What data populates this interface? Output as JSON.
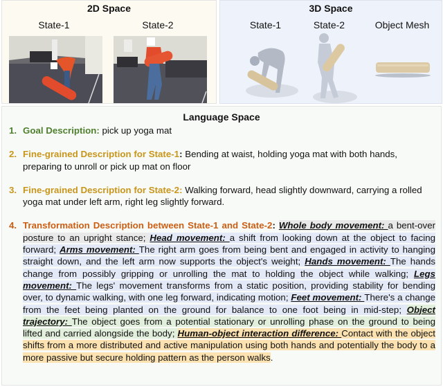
{
  "panels": {
    "space2d": {
      "title": "2D Space",
      "states": [
        {
          "label": "State-1",
          "image": "person-bending-picking-up-red-yoga-mat-photo"
        },
        {
          "label": "State-2",
          "image": "person-walking-carrying-red-yoga-mat-photo"
        }
      ]
    },
    "space3d": {
      "title": "3D Space",
      "states": [
        {
          "label": "State-1",
          "image": "3d-body-mesh-bending-over-mat"
        },
        {
          "label": "State-2",
          "image": "3d-body-mesh-carrying-mat"
        },
        {
          "label": "Object Mesh",
          "image": "3d-yoga-mat-mesh"
        }
      ]
    },
    "language": {
      "title": "Language Space",
      "items": [
        {
          "num": "1.",
          "label": "Goal Description:",
          "color": "#4f7f2f",
          "text": " pick up yoga mat"
        },
        {
          "num": "2.",
          "label": "Fine-grained Description for State-1",
          "color": "#c8961c",
          "sep": ":",
          "text": " Bending at waist, holding yoga mat with both hands, preparing to unroll or pick up mat on floor"
        },
        {
          "num": "3.",
          "label": "Fine-grained Description for State-2:",
          "color": "#c8961c",
          "text": " Walking forward, head slightly downward, carrying a rolled yoga mat under left arm, right leg slightly forward."
        },
        {
          "num": "4.",
          "label": "Transformation Description between State-1 and State-2",
          "color": "#cc5e14",
          "sep": ": ",
          "segments": [
            {
              "key": "Whole body movement: ",
              "text": "a bent-over posture to an upright stance",
              "after": "; ",
              "highlight": "#e9e9e9"
            },
            {
              "key": "Head movement: ",
              "text": "a shift from looking down at the object to facing forward",
              "after": "; ",
              "highlight": "#e3e9f6"
            },
            {
              "key": "Arms movement: ",
              "text": "The right arm goes from being bent and engaged in activity to hanging straight down, and the left arm now supports the object's weight",
              "after": "; ",
              "highlight": "#e3e9f6"
            },
            {
              "key": "Hands movement: ",
              "text": "The hands change from possibly gripping or unrolling the mat to holding the object while walking",
              "after": "; ",
              "highlight": "#e3e9f6"
            },
            {
              "key": "Legs movement: ",
              "text": "The legs' movement transforms from a static position, providing stability for bending over, to dynamic walking, with one leg forward, indicating motion",
              "after": "; ",
              "highlight": "#e3e9f6"
            },
            {
              "key": "Feet movement: ",
              "text": "There's a change from the feet being planted on the ground for balance to one foot being in mid-step",
              "after": "; ",
              "highlight": "#e3e9f6"
            },
            {
              "key": "Object trajectory: ",
              "text": "The object goes from a potential stationary or unrolling phase on the ground to being lifted and carried alongside the body",
              "after": "; ",
              "highlight": "#e2efdc"
            },
            {
              "key": "Human-object interaction difference: ",
              "text": "Contact with the object shifts from a more distributed and active manipulation using both hands and potentially the body to a more passive but secure holding pattern as the person walks",
              "after": ".",
              "highlight": "#fce2b0"
            }
          ]
        }
      ]
    }
  }
}
